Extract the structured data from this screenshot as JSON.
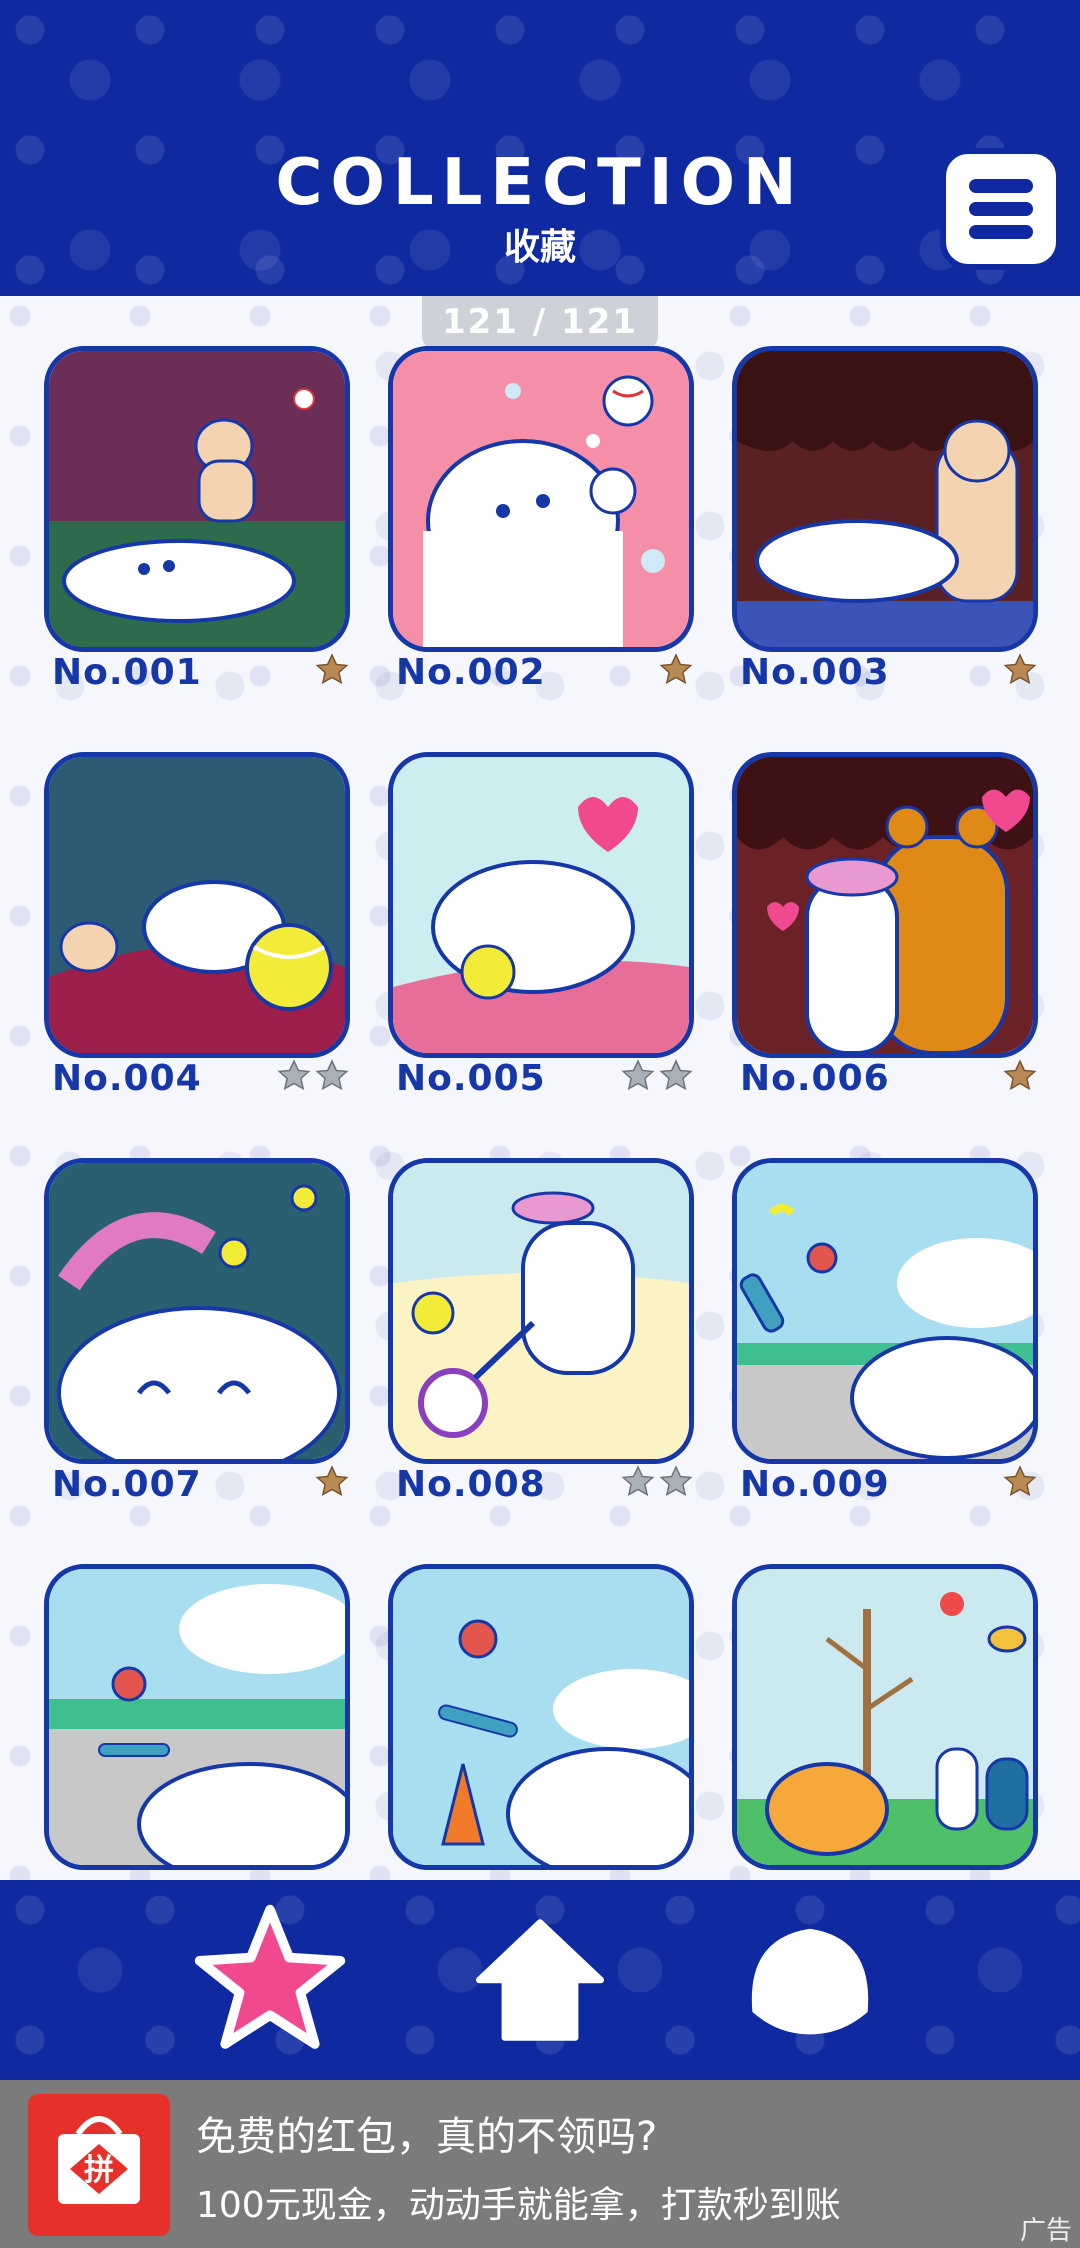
{
  "header": {
    "title": "COLLECTION",
    "subtitle": "收藏",
    "menu_icon": "hamburger-menu-icon"
  },
  "counter": "121 / 121",
  "items": [
    {
      "label": "No.001",
      "stars": 1,
      "star_color": "gold",
      "scene": "dog-lying-pug-ball"
    },
    {
      "label": "No.002",
      "stars": 1,
      "star_color": "gold",
      "scene": "dog-reaching-baseball"
    },
    {
      "label": "No.003",
      "stars": 1,
      "star_color": "gold",
      "scene": "dogs-chocolate-pug"
    },
    {
      "label": "No.004",
      "stars": 2,
      "star_color": "gray",
      "scene": "dog-tennis-ball-pug"
    },
    {
      "label": "No.005",
      "stars": 2,
      "star_color": "gray",
      "scene": "dog-chewing-ball-heart"
    },
    {
      "label": "No.006",
      "stars": 1,
      "star_color": "gold",
      "scene": "bear-hug-hearts"
    },
    {
      "label": "No.007",
      "stars": 1,
      "star_color": "gold",
      "scene": "dog-crying-bees"
    },
    {
      "label": "No.008",
      "stars": 2,
      "star_color": "gray",
      "scene": "dog-tennis-racket"
    },
    {
      "label": "No.009",
      "stars": 1,
      "star_color": "gold",
      "scene": "monkey-skateboard-fall"
    },
    {
      "label": "",
      "stars": 0,
      "star_color": "gold",
      "scene": "monkey-skate-road"
    },
    {
      "label": "",
      "stars": 0,
      "star_color": "gold",
      "scene": "monkey-skate-cone"
    },
    {
      "label": "",
      "stars": 0,
      "star_color": "gold",
      "scene": "tree-giraffe-balloon"
    }
  ],
  "bottom_nav": [
    {
      "name": "star",
      "icon": "star-icon",
      "color": "#f0498f"
    },
    {
      "name": "home",
      "icon": "home-icon",
      "color": "#ffffff"
    },
    {
      "name": "dog",
      "icon": "dog-head-icon",
      "color": "#ffffff"
    }
  ],
  "ad": {
    "title": "免费的红包，真的不领吗?",
    "description": "100元现金，动动手就能拿，打款秒到账",
    "tag": "广告",
    "logo_icon": "pinduoduo-logo"
  },
  "colors": {
    "brand_blue": "#0f2aa0",
    "card_border": "#1637a8",
    "gold_star": "#b88a52",
    "gray_star": "#a9b0b8",
    "nav_star_pink": "#f0498f"
  }
}
